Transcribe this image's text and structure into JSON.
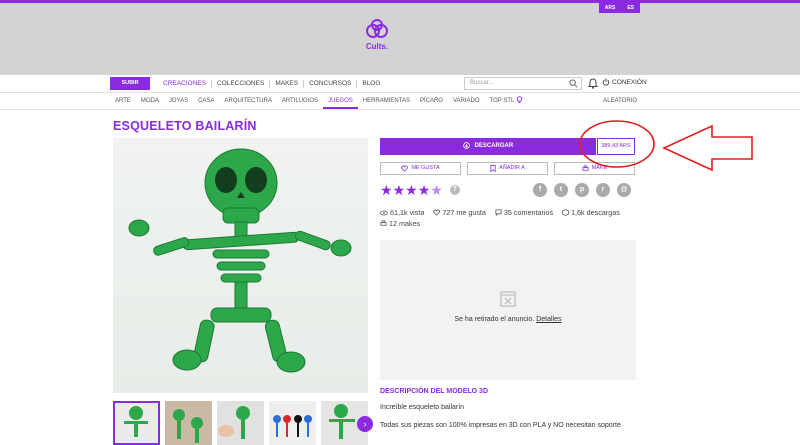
{
  "header": {
    "currency": [
      "ARS",
      "ES"
    ],
    "logo_text": "Cults."
  },
  "nav1": {
    "upload_label": "SUBIR",
    "items": [
      "CREACIONES",
      "COLECCIONES",
      "MAKES",
      "CONCURSOS",
      "BLOG"
    ],
    "search_placeholder": "Buscar...",
    "login_label": "CONEXIÓN"
  },
  "nav2": {
    "items": [
      "ARTE",
      "MODA",
      "JOYAS",
      "CASA",
      "ARQUITECTURA",
      "ARTILUGIOS",
      "JUEGOS",
      "HERRAMIENTAS",
      "PÍCARO",
      "VARIADO",
      "TOP STL"
    ],
    "active": "JUEGOS",
    "random_label": "ALEATORIO"
  },
  "product": {
    "title": "ESQUELETO BAILARÍN",
    "download_label": "DESCARGAR",
    "price": "389,43 ARS",
    "like_label": "ME GUSTA",
    "add_label": "AÑADIR A",
    "make_label": "MAKE",
    "rating": 4.5,
    "help_label": "?",
    "stats": {
      "views": "61,1k vista",
      "likes": "727 me gusta",
      "comments": "35 comentarios",
      "downloads": "1,6k descargas",
      "makes": "12 makes"
    },
    "ad_text": "Se ha retirado el anuncio.",
    "ad_link": "Detalles",
    "description_title": "DESCRIPCIÓN DEL MODELO 3D",
    "description_1": "Increíble esqueleto bailarín",
    "description_2": "Todas sus piezas son 100% impresas en 3D con PLA y NO necesitan soporte"
  },
  "socials": [
    "f",
    "t",
    "p",
    "r",
    "@"
  ],
  "colors": {
    "accent": "#8a2be2",
    "annotation": "#e02020",
    "skeleton": "#2ca84a"
  }
}
